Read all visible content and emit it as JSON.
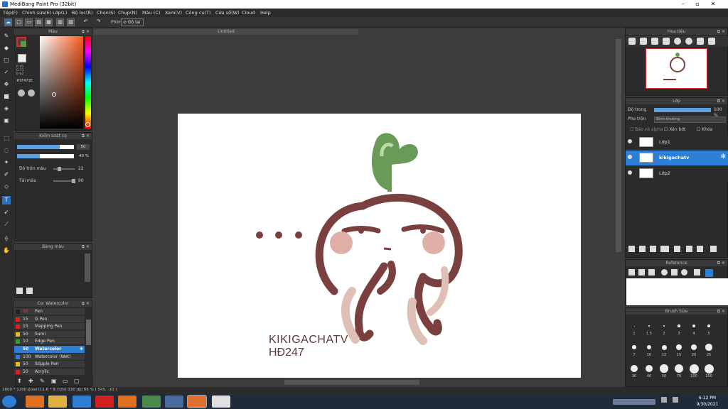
{
  "window": {
    "title": "MediBang Paint Pro (32bit)"
  },
  "menu": [
    "Tệp(F)",
    "Chỉnh sửa(E)",
    "Lớp(L)",
    "Bộ lọc(R)",
    "Chọn(S)",
    "Chụp(N)",
    "Màu (C)",
    "Xem(V)",
    "Công cụ(T)",
    "Cửa sổ(W)",
    "Cloud",
    "Help"
  ],
  "toolbar": {
    "brush_label": "Phím",
    "stabilizer_label": "Độ lại"
  },
  "color_panel": {
    "title": "Màu",
    "rgb": "R 95\nG 71\nB 62",
    "hex": "#5F473E",
    "primary_color": "#5f3b3a",
    "secondary_color": "#5a9a4a"
  },
  "control_panel": {
    "title": "Kiểm soát cọ",
    "size_value": "50",
    "opacity_value": "40 %",
    "size_fill": 0.75,
    "opacity_fill": 0.4,
    "blend_label": "Độ trộn màu",
    "blend_value": "22",
    "blend_fill": 0.22,
    "reload_label": "Tải màu",
    "reload_value": "90",
    "reload_fill": 0.9
  },
  "palette_panel": {
    "title": "Bảng màu"
  },
  "brush_panel": {
    "title": "Cọ: Watercolor",
    "items": [
      {
        "size": "30",
        "name": "Pen",
        "color": "#222222"
      },
      {
        "size": "15",
        "name": "G Pen",
        "color": "#e02020"
      },
      {
        "size": "15",
        "name": "Mapping Pen",
        "color": "#e02020"
      },
      {
        "size": "50",
        "name": "Sumi",
        "color": "#e0c020"
      },
      {
        "size": "10",
        "name": "Edge Pen",
        "color": "#30a030"
      },
      {
        "size": "50",
        "name": "Watercolor",
        "color": "#2d7fd6"
      },
      {
        "size": "100",
        "name": "Watercolor (Wet)",
        "color": "#2d7fd6"
      },
      {
        "size": "50",
        "name": "Stipple Pen",
        "color": "#e0c020"
      },
      {
        "size": "50",
        "name": "Acrylic",
        "color": "#e02020"
      }
    ],
    "selected_index": 5
  },
  "document": {
    "tab_title": "Untitled"
  },
  "artwork": {
    "text_line1": "KIKIGACHATV",
    "text_line2": "HĐ247",
    "dots": "• • •"
  },
  "navigator": {
    "title": "Hoa tiêu"
  },
  "layers": {
    "title": "Lớp",
    "opacity_label": "Độ trong",
    "opacity_value": "100 %",
    "blend_label": "Pha trộn",
    "blend_value": "Bình thường",
    "protect_alpha": "Bảo vệ alpha",
    "clipping": "Xén bớt",
    "lock": "Khóa",
    "items": [
      {
        "name": "Lớp1",
        "selected": false
      },
      {
        "name": "kikigachatv",
        "selected": true
      },
      {
        "name": "Lớp2",
        "selected": false
      }
    ]
  },
  "reference": {
    "title": "Reference"
  },
  "brush_size": {
    "title": "Brush Size",
    "labels": [
      "1",
      "1.5",
      "2",
      "3",
      "4",
      "5",
      "7",
      "10",
      "12",
      "15",
      "20",
      "25",
      "30",
      "40",
      "50",
      "70",
      "100",
      "150"
    ]
  },
  "status": {
    "text": "1600 * 1200 pixel  (11.6 * 8.7cm)  330 dpi  66 %  ( 545, -10 )"
  },
  "taskbar": {
    "time": "6:12 PM",
    "date": "9/30/2021"
  }
}
